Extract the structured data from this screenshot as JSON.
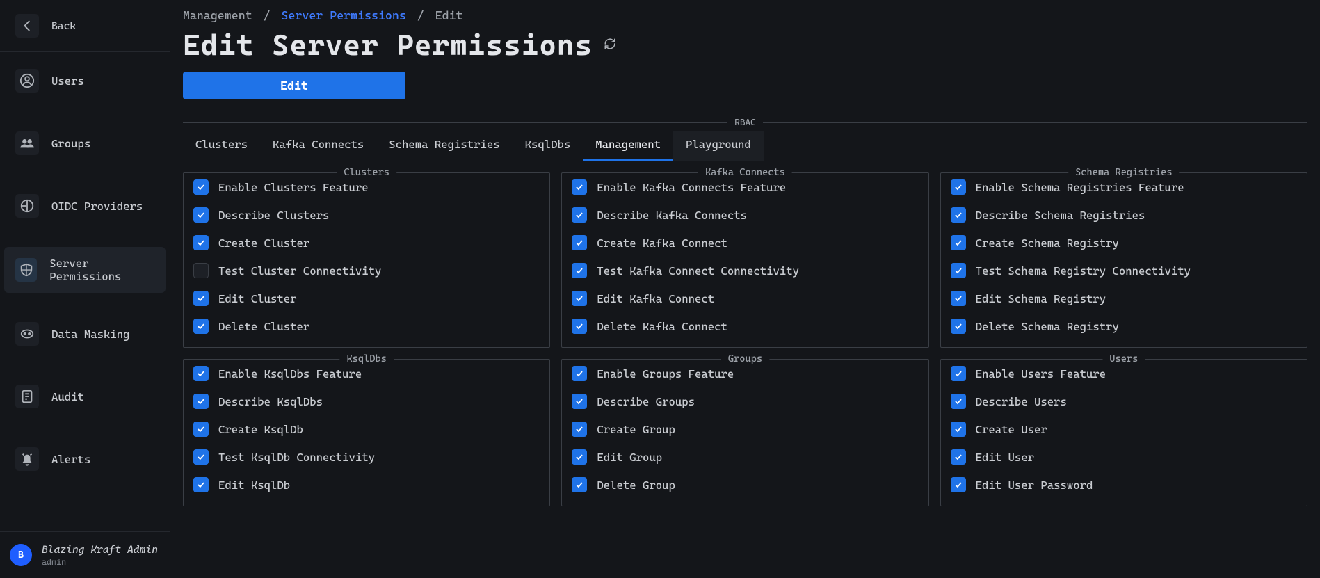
{
  "sidebar": {
    "back_label": "Back",
    "items": [
      {
        "label": "Users",
        "icon": "user-circle-icon",
        "active": false
      },
      {
        "label": "Groups",
        "icon": "users-group-icon",
        "active": false
      },
      {
        "label": "OIDC Providers",
        "icon": "oidc-icon",
        "active": false
      },
      {
        "label": "Server Permissions",
        "icon": "shield-icon",
        "active": true
      },
      {
        "label": "Data Masking",
        "icon": "mask-icon",
        "active": false
      },
      {
        "label": "Audit",
        "icon": "audit-icon",
        "active": false
      },
      {
        "label": "Alerts",
        "icon": "bell-icon",
        "active": false
      }
    ],
    "footer": {
      "avatar_letter": "B",
      "name": "Blazing Kraft Admin",
      "role": "admin"
    }
  },
  "breadcrumb": {
    "root": "Management",
    "link": "Server Permissions",
    "current": "Edit"
  },
  "page_title": "Edit Server Permissions",
  "edit_button": "Edit",
  "rbac_legend": "RBAC",
  "tabs": [
    {
      "label": "Clusters",
      "state": "normal"
    },
    {
      "label": "Kafka Connects",
      "state": "normal"
    },
    {
      "label": "Schema Registries",
      "state": "normal"
    },
    {
      "label": "KsqlDbs",
      "state": "normal"
    },
    {
      "label": "Management",
      "state": "active"
    },
    {
      "label": "Playground",
      "state": "hover"
    }
  ],
  "permission_groups": [
    {
      "title": "Clusters",
      "items": [
        {
          "label": "Enable Clusters Feature",
          "checked": true
        },
        {
          "label": "Describe Clusters",
          "checked": true
        },
        {
          "label": "Create Cluster",
          "checked": true
        },
        {
          "label": "Test Cluster Connectivity",
          "checked": false
        },
        {
          "label": "Edit Cluster",
          "checked": true
        },
        {
          "label": "Delete Cluster",
          "checked": true
        }
      ]
    },
    {
      "title": "Kafka Connects",
      "items": [
        {
          "label": "Enable Kafka Connects Feature",
          "checked": true
        },
        {
          "label": "Describe Kafka Connects",
          "checked": true
        },
        {
          "label": "Create Kafka Connect",
          "checked": true
        },
        {
          "label": "Test Kafka Connect Connectivity",
          "checked": true
        },
        {
          "label": "Edit Kafka Connect",
          "checked": true
        },
        {
          "label": "Delete Kafka Connect",
          "checked": true
        }
      ]
    },
    {
      "title": "Schema Registries",
      "items": [
        {
          "label": "Enable Schema Registries Feature",
          "checked": true
        },
        {
          "label": "Describe Schema Registries",
          "checked": true
        },
        {
          "label": "Create Schema Registry",
          "checked": true
        },
        {
          "label": "Test Schema Registry Connectivity",
          "checked": true
        },
        {
          "label": "Edit Schema Registry",
          "checked": true
        },
        {
          "label": "Delete Schema Registry",
          "checked": true
        }
      ]
    },
    {
      "title": "KsqlDbs",
      "items": [
        {
          "label": "Enable KsqlDbs Feature",
          "checked": true
        },
        {
          "label": "Describe KsqlDbs",
          "checked": true
        },
        {
          "label": "Create KsqlDb",
          "checked": true
        },
        {
          "label": "Test KsqlDb Connectivity",
          "checked": true
        },
        {
          "label": "Edit KsqlDb",
          "checked": true
        }
      ]
    },
    {
      "title": "Groups",
      "items": [
        {
          "label": "Enable Groups Feature",
          "checked": true
        },
        {
          "label": "Describe Groups",
          "checked": true
        },
        {
          "label": "Create Group",
          "checked": true
        },
        {
          "label": "Edit Group",
          "checked": true
        },
        {
          "label": "Delete Group",
          "checked": true
        }
      ]
    },
    {
      "title": "Users",
      "items": [
        {
          "label": "Enable Users Feature",
          "checked": true
        },
        {
          "label": "Describe Users",
          "checked": true
        },
        {
          "label": "Create User",
          "checked": true
        },
        {
          "label": "Edit User",
          "checked": true
        },
        {
          "label": "Edit User Password",
          "checked": true
        }
      ]
    }
  ]
}
